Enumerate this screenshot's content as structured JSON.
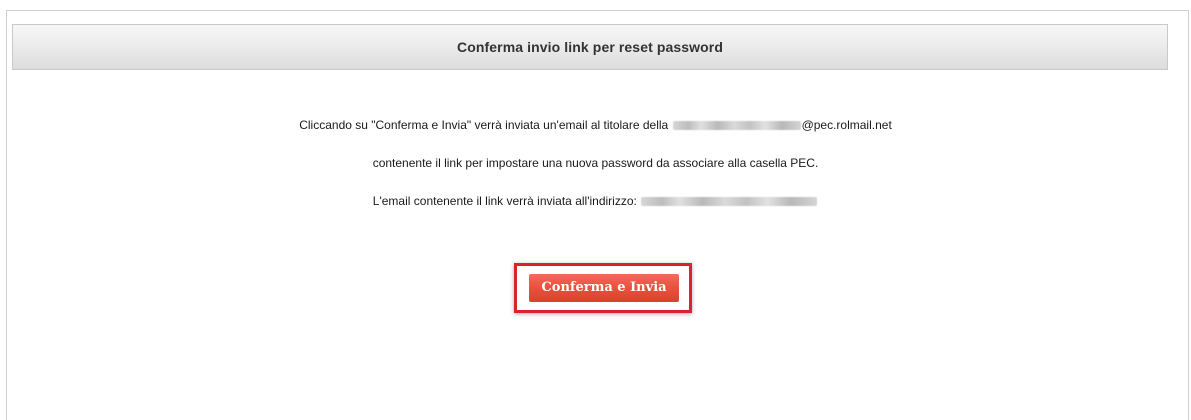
{
  "panel": {
    "title": "Conferma invio link per reset password"
  },
  "message": {
    "line1_text": "Cliccando su \"Conferma e Invia\" verrà inviata un'email al titolare della",
    "line1_domain": "@pec.rolmail.net",
    "line2_text": "contenente il link per impostare una nuova password da associare alla casella PEC.",
    "line3_text": "L'email contenente il link verrà inviata all'indirizzo:"
  },
  "actions": {
    "confirm_label": "Conferma e Invia"
  },
  "colors": {
    "button": "#e94e3c",
    "highlight_border": "#d9232d",
    "header_bg": "#e6e6e6"
  }
}
